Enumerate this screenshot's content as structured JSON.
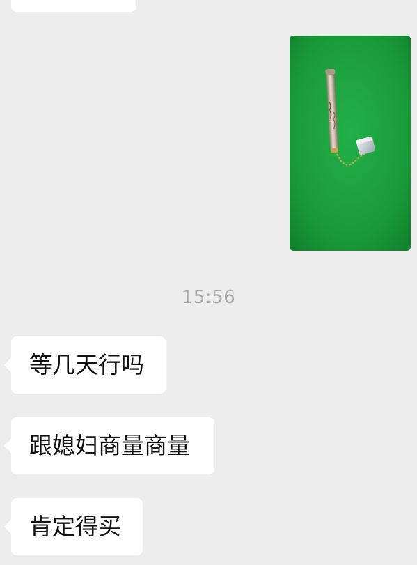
{
  "chat": {
    "image_message": {
      "icon": "pool-chalk-holder-photo"
    },
    "timestamp": "15:56",
    "messages": [
      {
        "text": "等几天行吗"
      },
      {
        "text": "跟媳妇商量商量"
      },
      {
        "text": "肯定得买"
      }
    ]
  }
}
